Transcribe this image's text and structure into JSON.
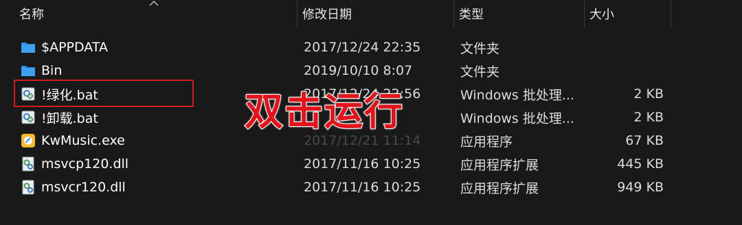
{
  "columns": {
    "name": "名称",
    "date": "修改日期",
    "type": "类型",
    "size": "大小"
  },
  "files": [
    {
      "name": "$APPDATA",
      "date": "2017/12/24 22:35",
      "type": "文件夹",
      "size": "",
      "icon": "folder-icon"
    },
    {
      "name": "Bin",
      "date": "2019/10/10 8:07",
      "type": "文件夹",
      "size": "",
      "icon": "folder-icon"
    },
    {
      "name": "!绿化.bat",
      "date": "2017/12/24 22:56",
      "type": "Windows 批处理...",
      "size": "2 KB",
      "icon": "batch-file-icon"
    },
    {
      "name": "!卸载.bat",
      "date": "",
      "type": "Windows 批处理...",
      "size": "2 KB",
      "icon": "batch-file-icon"
    },
    {
      "name": "KwMusic.exe",
      "date": "2017/12/21 11:14",
      "type": "应用程序",
      "size": "67 KB",
      "icon": "kwmusic-app-icon"
    },
    {
      "name": "msvcp120.dll",
      "date": "2017/11/16 10:25",
      "type": "应用程序扩展",
      "size": "445 KB",
      "icon": "dll-file-icon"
    },
    {
      "name": "msvcr120.dll",
      "date": "2017/11/16 10:25",
      "type": "应用程序扩展",
      "size": "949 KB",
      "icon": "dll-file-icon"
    }
  ],
  "annotation": {
    "text": "双击运行",
    "color": "#e0141c"
  },
  "colors": {
    "background": "#191919",
    "folder": "#2b8fe0",
    "highlight_border": "#d11a22"
  }
}
